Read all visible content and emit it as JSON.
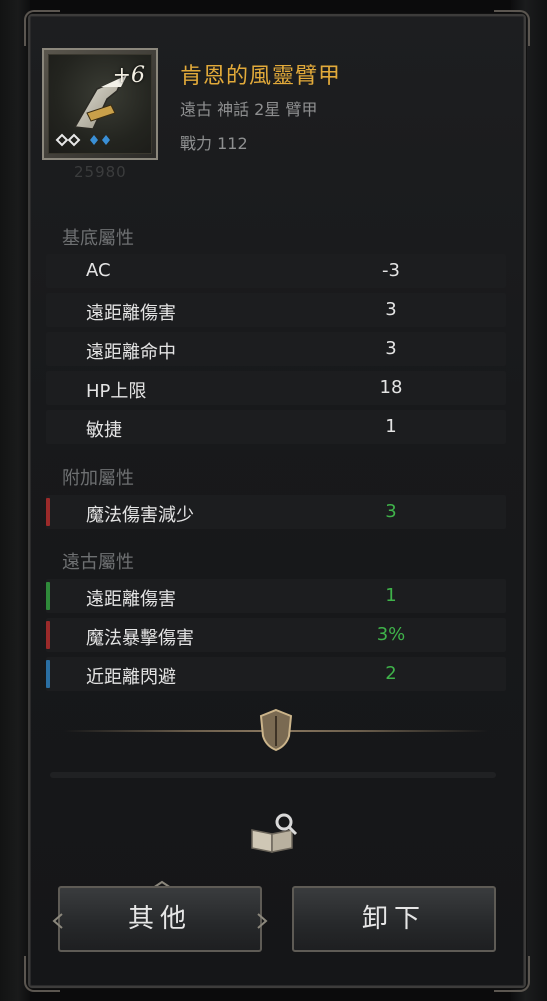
{
  "item": {
    "name": "肯恩的風靈臂甲",
    "enhance": "+6",
    "subtitle": "遠古 神話 2星 臂甲",
    "power": "戰力 112",
    "power_ghost": "25980",
    "icon": "armguard-item-icon"
  },
  "base_section": {
    "title": "基底屬性",
    "rows": [
      {
        "label": "AC",
        "value": "-3"
      },
      {
        "label": "遠距離傷害",
        "value": "3"
      },
      {
        "label": "遠距離命中",
        "value": "3"
      },
      {
        "label": "HP上限",
        "value": "18"
      },
      {
        "label": "敏捷",
        "value": "1"
      }
    ]
  },
  "extra_section": {
    "title": "附加屬性",
    "rows": [
      {
        "label": "魔法傷害減少",
        "value": "3",
        "bar_color": "#9b2a2a"
      }
    ]
  },
  "ancient_section": {
    "title": "遠古屬性",
    "rows": [
      {
        "label": "遠距離傷害",
        "value": "1",
        "bar_color": "#2f8a3a"
      },
      {
        "label": "魔法暴擊傷害",
        "value": "3%",
        "bar_color": "#9b2a2a"
      },
      {
        "label": "近距離閃避",
        "value": "2",
        "bar_color": "#2a6fa3"
      }
    ]
  },
  "buttons": {
    "other": "其他",
    "unequip": "卸下"
  },
  "colors": {
    "name": "#e2aa3a",
    "value_green": "#3fb34a",
    "red_bar": "#9b2a2a",
    "green_bar": "#2f8a3a",
    "blue_bar": "#2a6fa3"
  }
}
